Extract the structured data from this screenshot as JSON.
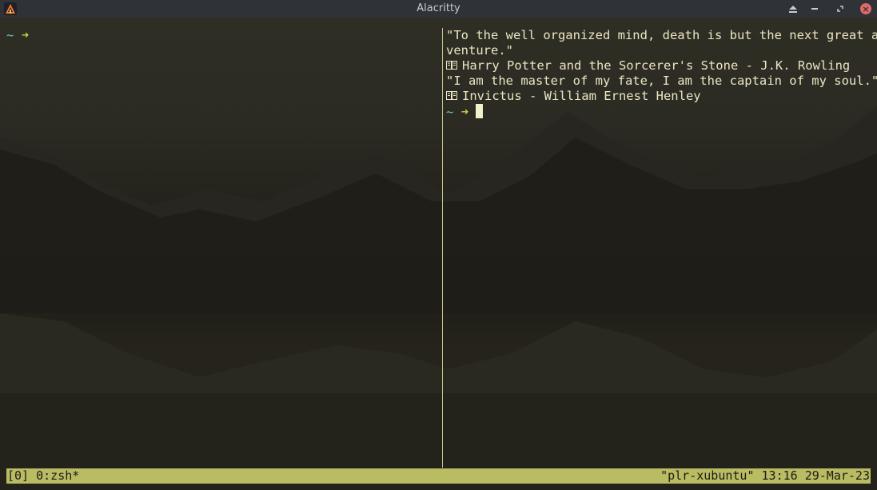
{
  "window": {
    "title": "Alacritty",
    "app_icon": "alacritty-icon",
    "controls": {
      "shade": "shade-icon",
      "minimize": "minimize-icon",
      "maximize": "maximize-icon",
      "close": "close-icon"
    }
  },
  "left_pane": {
    "prompt_tilde": "~",
    "prompt_arrow": "➜"
  },
  "right_pane": {
    "quote1_line1": "\"To the well organized mind, death is but the next great ad",
    "quote1_line2": "venture.\"",
    "quote1_source": "Harry Potter and the Sorcerer's Stone - J.K. Rowling",
    "quote2_line1": "\"I am the master of my fate, I am the captain of my soul.\"",
    "quote2_source": "Invictus - William Ernest Henley",
    "source_icon": "book-icon",
    "prompt_tilde": "~",
    "prompt_arrow": "➜"
  },
  "statusbar": {
    "left": "[0] 0:zsh*",
    "right": "\"plr-xubuntu\" 13:16 29-Mar-23"
  },
  "colors": {
    "background": "#2b2a22",
    "status_bar": "#b9bc63",
    "prompt_tilde": "#6fc7c1",
    "prompt_arrow": "#c9cc4a",
    "text": "#ece6c4",
    "close_button": "#e06a6a"
  }
}
